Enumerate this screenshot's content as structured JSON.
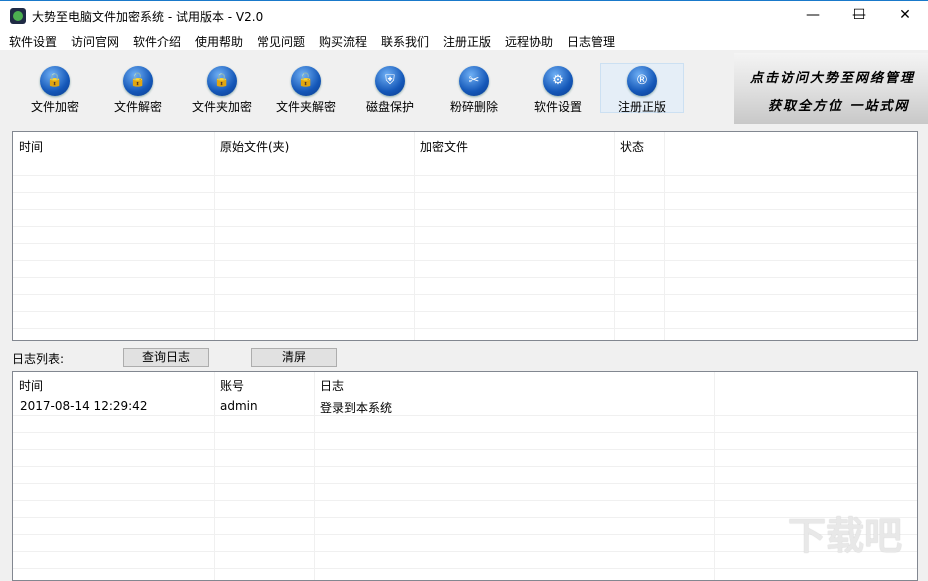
{
  "window": {
    "title": "大势至电脑文件加密系统 - 试用版本 - V2.0",
    "minimize": "—",
    "maximize": "☐",
    "close": "✕"
  },
  "menu": [
    "软件设置",
    "访问官网",
    "软件介绍",
    "使用帮助",
    "常见问题",
    "购买流程",
    "联系我们",
    "注册正版",
    "远程协助",
    "日志管理"
  ],
  "toolbar": [
    {
      "label": "文件加密",
      "icon": "file-lock-icon",
      "glyph": "🔒"
    },
    {
      "label": "文件解密",
      "icon": "file-unlock-icon",
      "glyph": "🔓"
    },
    {
      "label": "文件夹加密",
      "icon": "folder-lock-icon",
      "glyph": "🔒"
    },
    {
      "label": "文件夹解密",
      "icon": "folder-unlock-icon",
      "glyph": "🔓"
    },
    {
      "label": "磁盘保护",
      "icon": "disk-shield-icon",
      "glyph": "⛨"
    },
    {
      "label": "粉碎删除",
      "icon": "shred-icon",
      "glyph": "✂"
    },
    {
      "label": "软件设置",
      "icon": "gear-icon",
      "glyph": "⚙"
    },
    {
      "label": "注册正版",
      "icon": "registered-icon",
      "glyph": "®"
    }
  ],
  "banner": {
    "line1": "点击访问大势至网络管理",
    "line2": "获取全方位 一站式网"
  },
  "file_table": {
    "columns": [
      "时间",
      "原始文件(夹)",
      "加密文件",
      "状态"
    ],
    "rows": []
  },
  "log": {
    "label": "日志列表:",
    "query_button": "查询日志",
    "clear_button": "清屏",
    "columns": [
      "时间",
      "账号",
      "日志"
    ],
    "rows": [
      {
        "time": "2017-08-14 12:29:42",
        "account": "admin",
        "message": "登录到本系统"
      }
    ]
  },
  "watermark": "下载吧"
}
